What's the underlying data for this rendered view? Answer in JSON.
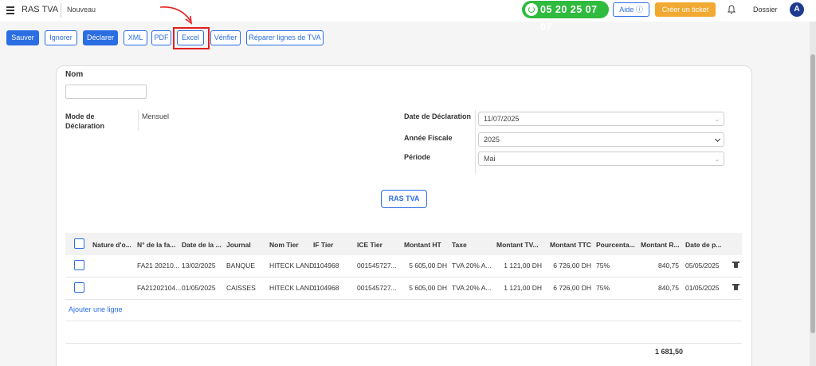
{
  "header": {
    "title": "RAS TVA",
    "subtitle": "Nouveau",
    "phone": "05 20 25 07 07",
    "aide_label": "Aide",
    "ticket_label": "Créer un ticket",
    "dossier_label": "Dossier",
    "avatar_initial": "A"
  },
  "toolbar": {
    "sauver": "Sauver",
    "ignorer": "Ignorer",
    "declarer": "Déclarer",
    "xml": "XML",
    "pdf": "PDF",
    "excel": "Excel",
    "verifier": "Vérifier",
    "reparer": "Réparer lignes de TVA"
  },
  "form": {
    "nom_label": "Nom",
    "nom_value": "",
    "mode_label_1": "Mode de",
    "mode_label_2": "Déclaration",
    "mode_value": "Mensuel",
    "date_label": "Date de Déclaration",
    "date_value": "11/07/2025",
    "annee_label": "Année Fiscale",
    "annee_value": "2025",
    "periode_label": "Période",
    "periode_value": "Mai",
    "ras_button": "RAS TVA"
  },
  "table": {
    "headers": [
      "Nature d'o...",
      "N° de la fa...",
      "Date de la ...",
      "Journal",
      "Nom Tier",
      "IF Tier",
      "ICE Tier",
      "Montant HT",
      "Taxe",
      "Montant TV...",
      "Montant TTC",
      "Pourcenta...",
      "Montant R...",
      "Date de p..."
    ],
    "rows": [
      {
        "nature": "",
        "facture": "FA21 20210...",
        "date": "13/02/2025",
        "journal": "BANQUE",
        "nom_tier": "HITECK LAND",
        "if_tier": "1104968",
        "ice_tier": "001545727...",
        "montant_ht": "5 605,00 DH",
        "taxe": "TVA 20% A...",
        "montant_tva": "1 121,00 DH",
        "montant_ttc": "6 726,00 DH",
        "pourcentage": "75%",
        "montant_r": "840,75",
        "date_p": "05/05/2025"
      },
      {
        "nature": "",
        "facture": "FA21202104...",
        "date": "01/05/2025",
        "journal": "CAISSES",
        "nom_tier": "HITECK LAND",
        "if_tier": "1104968",
        "ice_tier": "001545727...",
        "montant_ht": "5 605,00 DH",
        "taxe": "TVA 20% A...",
        "montant_tva": "1 121,00 DH",
        "montant_ttc": "6 726,00 DH",
        "pourcentage": "75%",
        "montant_r": "840,75",
        "date_p": "01/05/2025"
      }
    ],
    "add_line": "Ajouter une ligne",
    "total": "1 681,50"
  }
}
